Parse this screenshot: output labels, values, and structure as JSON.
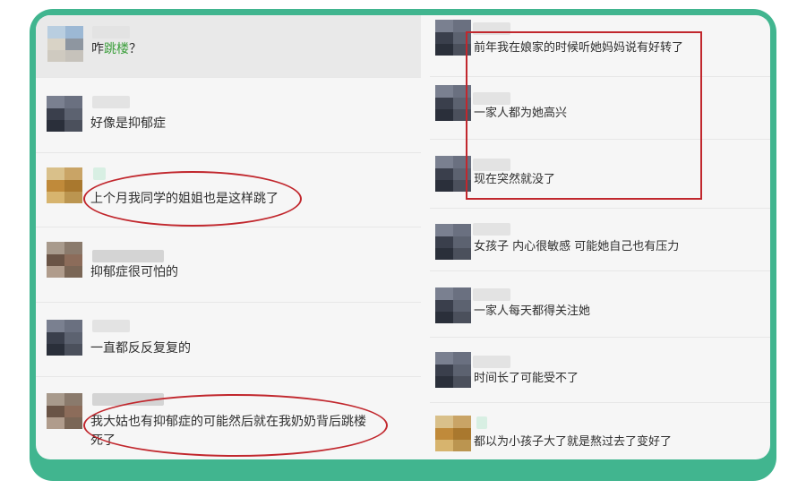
{
  "colors": {
    "frame": "#41b58f",
    "panel": "#f6f6f6",
    "annotation": "#c1272d",
    "highlight_text": "#3a9e3a"
  },
  "left_comments": [
    {
      "prefix": "咋",
      "highlight": "跳楼",
      "suffix": "？"
    },
    {
      "text": "好像是抑郁症"
    },
    {
      "text": "上个月我同学的姐姐也是这样跳了"
    },
    {
      "text": "抑郁症很可怕的"
    },
    {
      "text": "一直都反反复复的"
    },
    {
      "line1": "我大姑也有抑郁症的可能然后就在我奶奶背后跳楼",
      "line2": "死了"
    }
  ],
  "right_comments": [
    {
      "text": "前年我在娘家的时候听她妈妈说有好转了"
    },
    {
      "text": "一家人都为她高兴"
    },
    {
      "text": "现在突然就没了"
    },
    {
      "text": "女孩子 内心很敏感 可能她自己也有压力"
    },
    {
      "text": "一家人每天都得关注她"
    },
    {
      "text": "时间长了可能受不了"
    },
    {
      "text": "都以为小孩子大了就是熬过去了变好了"
    }
  ],
  "avatar_icon": "pixelated-avatar-icon"
}
